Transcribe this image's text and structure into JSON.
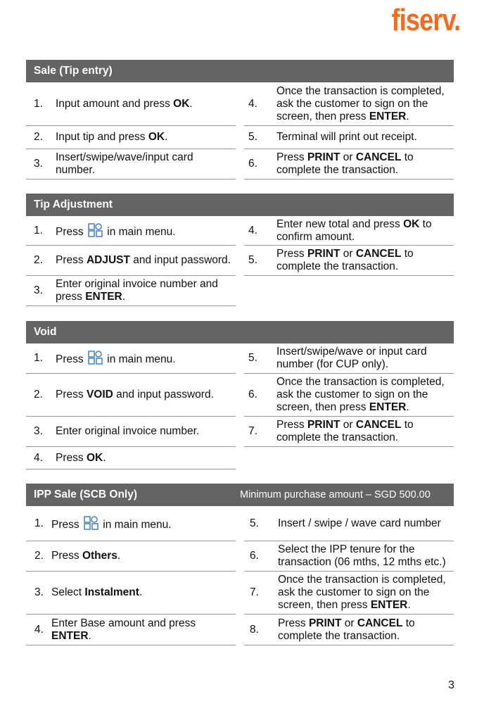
{
  "brand": {
    "logo_text": "fiserv.",
    "accent_color": "#f26b21"
  },
  "header_bar_color": "#646464",
  "sections": [
    {
      "title": "Sale (Tip entry)",
      "left": [
        {
          "num": "1.",
          "pre": "Input amount and press ",
          "bold": "OK",
          "post": "."
        },
        {
          "num": "2.",
          "pre": "Input tip and press ",
          "bold": "OK",
          "post": "."
        },
        {
          "num": "3.",
          "pre": "Insert/swipe/wave/input card number.",
          "bold": "",
          "post": ""
        }
      ],
      "right": [
        {
          "num": "4.",
          "pre": "Once the transaction is completed, ask the customer to sign on the screen, then press ",
          "bold": "ENTER",
          "post": "."
        },
        {
          "num": "5.",
          "pre": "Terminal will print out receipt.",
          "bold": "",
          "post": ""
        },
        {
          "num": "6.",
          "pre": "Press ",
          "bold": "PRINT",
          "mid": " or ",
          "bold2": "CANCEL",
          "post": " to complete the transaction."
        }
      ]
    },
    {
      "title": "Tip Adjustment",
      "left": [
        {
          "num": "1.",
          "pre": "Press ",
          "icon": "menu-grid-icon",
          "post": " in main menu."
        },
        {
          "num": "2.",
          "pre": "Press ",
          "bold": "ADJUST",
          "post": " and input password."
        },
        {
          "num": "3.",
          "pre": "Enter original invoice number and press ",
          "bold": "ENTER",
          "post": "."
        }
      ],
      "right": [
        {
          "num": "4.",
          "pre": "Enter new total and press ",
          "bold": "OK",
          "post": " to confirm amount."
        },
        {
          "num": "5.",
          "pre": "Press ",
          "bold": "PRINT",
          "mid": " or ",
          "bold2": "CANCEL",
          "post": " to complete the transaction."
        }
      ]
    },
    {
      "title": "Void",
      "left": [
        {
          "num": "1.",
          "pre": "Press ",
          "icon": "menu-grid-icon",
          "post": " in main menu."
        },
        {
          "num": "2.",
          "pre": "Press ",
          "bold": "VOID",
          "post": " and input password."
        },
        {
          "num": "3.",
          "pre": "Enter original invoice number.",
          "bold": "",
          "post": ""
        },
        {
          "num": "4.",
          "pre": "Press ",
          "bold": "OK",
          "post": "."
        }
      ],
      "right": [
        {
          "num": "5.",
          "pre": "Insert/swipe/wave or input card number (for CUP only).",
          "bold": "",
          "post": ""
        },
        {
          "num": "6.",
          "pre": "Once the transaction is completed, ask the customer to sign on the screen, then press ",
          "bold": "ENTER",
          "post": "."
        },
        {
          "num": "7.",
          "pre": "Press ",
          "bold": "PRINT",
          "mid": " or ",
          "bold2": "CANCEL",
          "post": " to complete the transaction."
        }
      ]
    },
    {
      "title": "IPP Sale (SCB Only)",
      "note": "Minimum purchase amount – SGD 500.00",
      "left": [
        {
          "num": "1.",
          "pre": "Press ",
          "icon": "menu-grid-icon",
          "post": " in main menu."
        },
        {
          "num": "2.",
          "pre": "Press ",
          "bold": "Others",
          "post": "."
        },
        {
          "num": "3.",
          "pre": "Select ",
          "bold": "Instalment",
          "post": "."
        },
        {
          "num": "4.",
          "pre": "Enter Base amount and press ",
          "bold": "ENTER",
          "post": "."
        }
      ],
      "right": [
        {
          "num": "5.",
          "pre": "Insert / swipe / wave card number",
          "bold": "",
          "post": ""
        },
        {
          "num": "6.",
          "pre": "Select the IPP tenure for the transaction (06 mths, 12 mths etc.)",
          "bold": "",
          "post": ""
        },
        {
          "num": "7.",
          "pre": "Once the transaction is completed, ask the customer to sign on the screen, then press ",
          "bold": "ENTER",
          "post": "."
        },
        {
          "num": "8.",
          "pre": "Press ",
          "bold": "PRINT",
          "mid": " or ",
          "bold2": "CANCEL",
          "post": " to complete the transaction."
        }
      ]
    }
  ],
  "page_number": "3"
}
